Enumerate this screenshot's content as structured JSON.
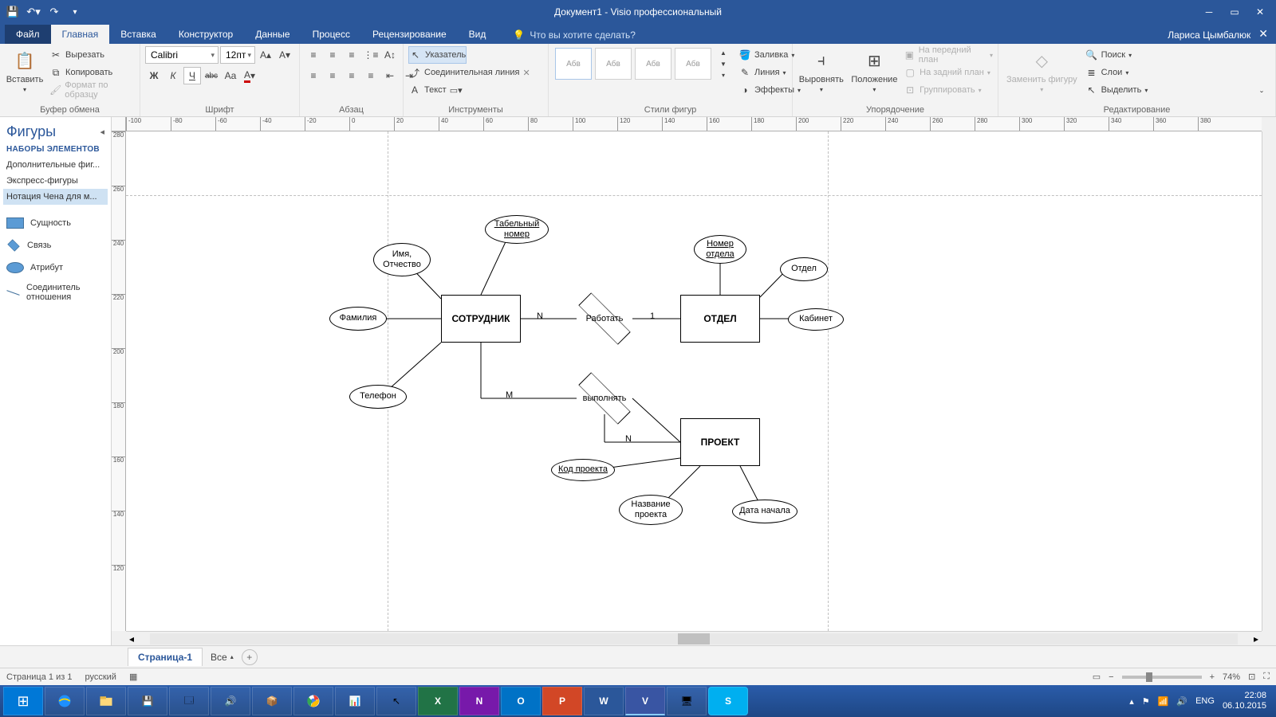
{
  "titlebar": {
    "title": "Документ1 - Visio профессиональный"
  },
  "tabs": {
    "file": "Файл",
    "home": "Главная",
    "insert": "Вставка",
    "design": "Конструктор",
    "data": "Данные",
    "process": "Процесс",
    "review": "Рецензирование",
    "view": "Вид",
    "tellme_placeholder": "Что вы хотите сделать?",
    "username": "Лариса Цымбалюк"
  },
  "ribbon": {
    "clipboard": {
      "paste": "Вставить",
      "cut": "Вырезать",
      "copy": "Копировать",
      "format_painter": "Формат по образцу",
      "label": "Буфер обмена"
    },
    "font": {
      "name": "Calibri",
      "size": "12пт",
      "bold": "Ж",
      "italic": "К",
      "underline": "Ч",
      "strike": "abc",
      "case": "Aa",
      "label": "Шрифт"
    },
    "paragraph": {
      "label": "Абзац"
    },
    "tools": {
      "pointer": "Указатель",
      "connector": "Соединительная линия",
      "text": "Текст",
      "label": "Инструменты"
    },
    "styles": {
      "sample": "Абв",
      "label": "Стили фигур",
      "fill": "Заливка",
      "line": "Линия",
      "effects": "Эффекты"
    },
    "arrange": {
      "align": "Выровнять",
      "position": "Положение",
      "front": "На передний план",
      "back": "На задний план",
      "group": "Группировать",
      "label": "Упорядочение"
    },
    "edit": {
      "change_shape": "Заменить фигуру",
      "find": "Поиск",
      "layers": "Слои",
      "select": "Выделить",
      "label": "Редактирование"
    }
  },
  "shapes_panel": {
    "title": "Фигуры",
    "subtitle": "НАБОРЫ ЭЛЕМЕНТОВ",
    "stencils": [
      "Дополнительные фиг...",
      "Экспресс-фигуры",
      "Нотация Чена для м..."
    ],
    "shapes": {
      "entity": "Сущность",
      "relation": "Связь",
      "attribute": "Атрибут",
      "rel_connector": "Соединитель отношения"
    }
  },
  "ruler_h": [
    "-100",
    "-80",
    "-60",
    "-40",
    "-20",
    "0",
    "20",
    "40",
    "60",
    "80",
    "100",
    "120",
    "140",
    "160",
    "180",
    "200",
    "220",
    "240",
    "260",
    "280",
    "300",
    "320",
    "340",
    "360",
    "380"
  ],
  "ruler_v": [
    "280",
    "260",
    "240",
    "220",
    "200",
    "180",
    "160",
    "140",
    "120"
  ],
  "diagram": {
    "entities": {
      "employee": "СОТРУДНИК",
      "department": "ОТДЕЛ",
      "project": "ПРОЕКТ"
    },
    "relations": {
      "work": "Работать",
      "perform": "выполнять"
    },
    "attributes": {
      "tab_number": "Табельный номер",
      "name_patronymic": "Имя, Отчество",
      "surname": "Фамилия",
      "phone": "Телефон",
      "dept_number": "Номер отдела",
      "dept": "Отдел",
      "cabinet": "Кабинет",
      "project_code": "Код проекта",
      "project_name": "Название проекта",
      "start_date": "Дата начала"
    },
    "cardinality": {
      "N": "N",
      "one": "1",
      "M": "M"
    }
  },
  "pagetabs": {
    "page1": "Страница-1",
    "all": "Все"
  },
  "statusbar": {
    "page_info": "Страница 1 из 1",
    "lang": "русский",
    "zoom": "74%"
  },
  "taskbar": {
    "lang": "ENG",
    "time": "22:08",
    "date": "06.10.2015"
  }
}
